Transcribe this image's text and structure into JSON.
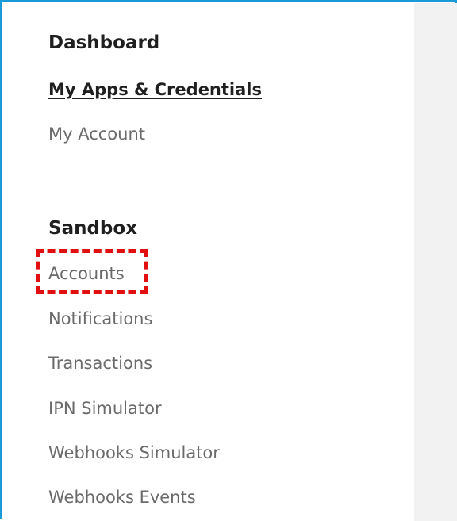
{
  "sidebar": {
    "dashboard_heading": "Dashboard",
    "my_apps_label": "My Apps & Credentials",
    "my_account_label": "My Account",
    "sandbox_heading": "Sandbox",
    "items": [
      {
        "label": "Accounts"
      },
      {
        "label": "Notifications"
      },
      {
        "label": "Transactions"
      },
      {
        "label": "IPN Simulator"
      },
      {
        "label": "Webhooks Simulator"
      },
      {
        "label": "Webhooks Events"
      }
    ]
  },
  "colors": {
    "frame_border": "#1a9ad6",
    "highlight": "#e01010",
    "heading_text": "#1f1f1f",
    "link_text": "#6a6a6a",
    "content_bg": "#f2f2f2"
  }
}
